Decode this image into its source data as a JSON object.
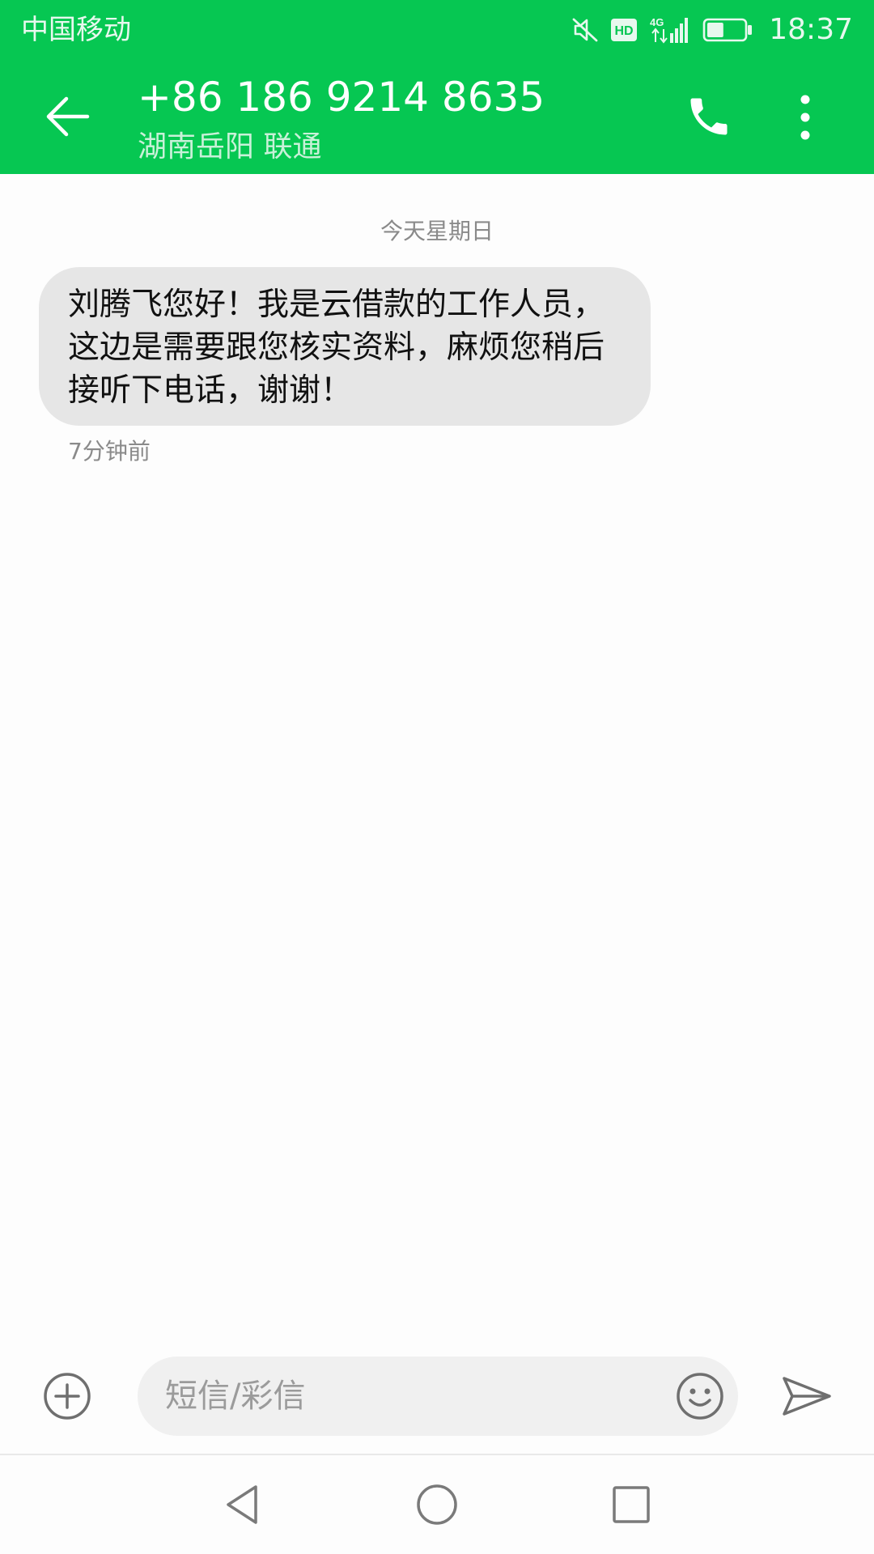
{
  "status_bar": {
    "carrier": "中国移动",
    "hd_badge": "HD",
    "network": "4G",
    "time": "18:37",
    "battery_level": 0.45,
    "icons": [
      "mute-icon",
      "hd-icon",
      "signal-icon",
      "battery-icon"
    ]
  },
  "header": {
    "title": "+86 186 9214 8635",
    "subtitle": "湖南岳阳 联通",
    "icons": [
      "back-arrow-icon",
      "phone-icon",
      "more-vertical-icon"
    ]
  },
  "conversation": {
    "date_label": "今天星期日",
    "messages": [
      {
        "text": "刘腾飞您好！我是云借款的工作人员，这边是需要跟您核实资料，麻烦您稍后接听下电话，谢谢！",
        "time": "7分钟前",
        "direction": "incoming"
      }
    ]
  },
  "compose": {
    "placeholder": "短信/彩信",
    "value": "",
    "icons": [
      "add-icon",
      "emoji-icon",
      "send-icon"
    ]
  },
  "nav_bar": {
    "icons": [
      "nav-back-icon",
      "nav-home-icon",
      "nav-recents-icon"
    ]
  },
  "colors": {
    "accent": "#06c752",
    "bubble": "#e6e6e6",
    "background": "#fdfdfd",
    "muted_text": "#8a8a8a"
  }
}
